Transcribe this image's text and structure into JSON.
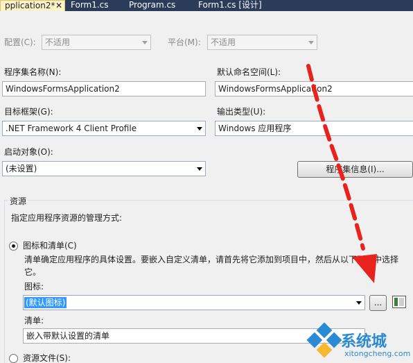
{
  "tabs": [
    {
      "label": "pplication2*",
      "close": "✕",
      "active": true
    },
    {
      "label": "Form1.cs",
      "active": false
    },
    {
      "label": "Program.cs",
      "active": false
    },
    {
      "label": "Form1.cs [设计]",
      "active": false
    }
  ],
  "config": {
    "config_label": "配置(C):",
    "config_value": "不适用",
    "platform_label": "平台(M):",
    "platform_value": "不适用"
  },
  "assembly": {
    "name_label": "程序集名称(N):",
    "name_value": "WindowsFormsApplication2",
    "namespace_label": "默认命名空间(L):",
    "namespace_value": "WindowsFormsApplication2",
    "framework_label": "目标框架(G):",
    "framework_value": ".NET Framework 4 Client Profile",
    "output_label": "输出类型(U):",
    "output_value": "Windows 应用程序",
    "startup_label": "启动对象(O):",
    "startup_value": "(未设置)",
    "info_button": "程序集信息(I)..."
  },
  "resources": {
    "group_title": "资源",
    "description": "指定应用程序资源的管理方式:",
    "option_icon_manifest": "图标和清单(C)",
    "option_icon_manifest_desc_1": "清单确定应用程序的具体设置。要嵌入自定义清单，请首先将它添加到项目中，然后从以下列表中选择",
    "option_icon_manifest_desc_2": "它。",
    "icon_label": "图标:",
    "icon_value": "(默认图标)",
    "browse_button": "...",
    "manifest_label": "清单:",
    "manifest_value": "嵌入带默认设置的清单",
    "option_resource_file": "资源文件(S):"
  },
  "watermark": {
    "brand": "系统城",
    "url": "xitongcheng.com"
  },
  "colors": {
    "annotation_arrow": "#e8231d",
    "selection": "#3399ff",
    "tab_strip": "#2b3c5a",
    "active_tab": "#fdf3c9"
  }
}
